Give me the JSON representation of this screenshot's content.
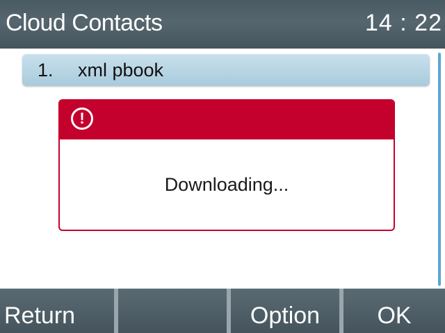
{
  "header": {
    "title": "Cloud Contacts",
    "time": "14 : 22"
  },
  "list": {
    "items": [
      {
        "number": "1.",
        "label": "xml pbook"
      }
    ]
  },
  "dialog": {
    "icon": "alert-circle-icon",
    "icon_glyph": "!",
    "message": "Downloading..."
  },
  "softkeys": {
    "key1": "Return",
    "key2": "",
    "key3": "Option",
    "key4": "OK"
  },
  "colors": {
    "header_bg": "#4f5f68",
    "dialog_accent": "#c4002c",
    "selected_item": "#b4d4e4",
    "scrollbar": "#5aa6d0"
  }
}
